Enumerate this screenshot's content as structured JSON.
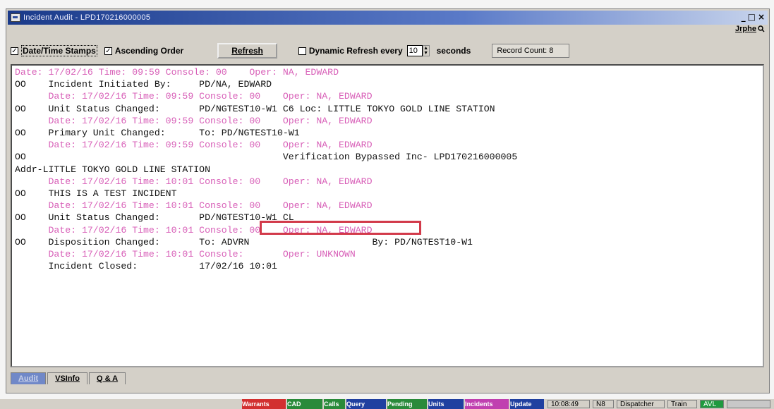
{
  "window": {
    "title": "Incident Audit - LPD170216000005",
    "controls": [
      "_",
      "□",
      "×"
    ],
    "user": "Jrphe"
  },
  "toolbar": {
    "date_time_stamps": {
      "label": "Date/Time Stamps",
      "checked": true
    },
    "ascending_order": {
      "label": "Ascending Order",
      "checked": true
    },
    "refresh_label": "Refresh",
    "dynamic_refresh": {
      "label": "Dynamic Refresh every",
      "checked": false,
      "value": "10",
      "unit": "seconds"
    },
    "record_count": "Record Count: 8"
  },
  "log": [
    {
      "kind": "ts",
      "text": "Date: 17/02/16 Time: 09:59 Console: 00    Oper: NA, EDWARD"
    },
    {
      "kind": "msg",
      "text": "OO    Incident Initiated By:     PD/NA, EDWARD"
    },
    {
      "kind": "ts",
      "text": "      Date: 17/02/16 Time: 09:59 Console: 00    Oper: NA, EDWARD"
    },
    {
      "kind": "msg",
      "text": "OO    Unit Status Changed:       PD/NGTEST10-W1 C6 Loc: LITTLE TOKYO GOLD LINE STATION"
    },
    {
      "kind": "ts",
      "text": "      Date: 17/02/16 Time: 09:59 Console: 00    Oper: NA, EDWARD"
    },
    {
      "kind": "msg",
      "text": "OO    Primary Unit Changed:      To: PD/NGTEST10-W1"
    },
    {
      "kind": "ts",
      "text": "      Date: 17/02/16 Time: 09:59 Console: 00    Oper: NA, EDWARD"
    },
    {
      "kind": "msg",
      "text": "OO                                              Verification Bypassed Inc- LPD170216000005"
    },
    {
      "kind": "msg",
      "text": "Addr-LITTLE TOKYO GOLD LINE STATION"
    },
    {
      "kind": "ts",
      "text": "      Date: 17/02/16 Time: 10:01 Console: 00    Oper: NA, EDWARD"
    },
    {
      "kind": "msg",
      "text": "OO    THIS IS A TEST INCIDENT"
    },
    {
      "kind": "ts",
      "text": "      Date: 17/02/16 Time: 10:01 Console: 00    Oper: NA, EDWARD"
    },
    {
      "kind": "msg",
      "text": "OO    Unit Status Changed:       PD/NGTEST10-W1 CL"
    },
    {
      "kind": "ts",
      "text": "      Date: 17/02/16 Time: 10:01 Console: 00    Oper: NA, EDWARD"
    },
    {
      "kind": "msg",
      "text": "OO    Disposition Changed:       To: ADVRN                      By: PD/NGTEST10-W1"
    },
    {
      "kind": "ts",
      "text": "      Date: 17/02/16 Time: 10:01 Console:       Oper: UNKNOWN"
    },
    {
      "kind": "msg",
      "text": "      Incident Closed:           17/02/16 10:01"
    }
  ],
  "tabs": [
    "Audit",
    "VSInfo",
    "Q & A"
  ],
  "taskbar": {
    "buttons": [
      "Warrants",
      "CAD",
      "Calls",
      "Query",
      "Pending",
      "Units",
      "Incidents",
      "Update"
    ],
    "time": "10:08:49",
    "station": "N8",
    "role": "Dispatcher",
    "mode": "Train",
    "avl": "AVL",
    "colors": {
      "red": "#d23030",
      "green": "#2a8a3a",
      "blue": "#2040a0",
      "magenta": "#c040b0",
      "avl": "#1f9a3f"
    }
  }
}
